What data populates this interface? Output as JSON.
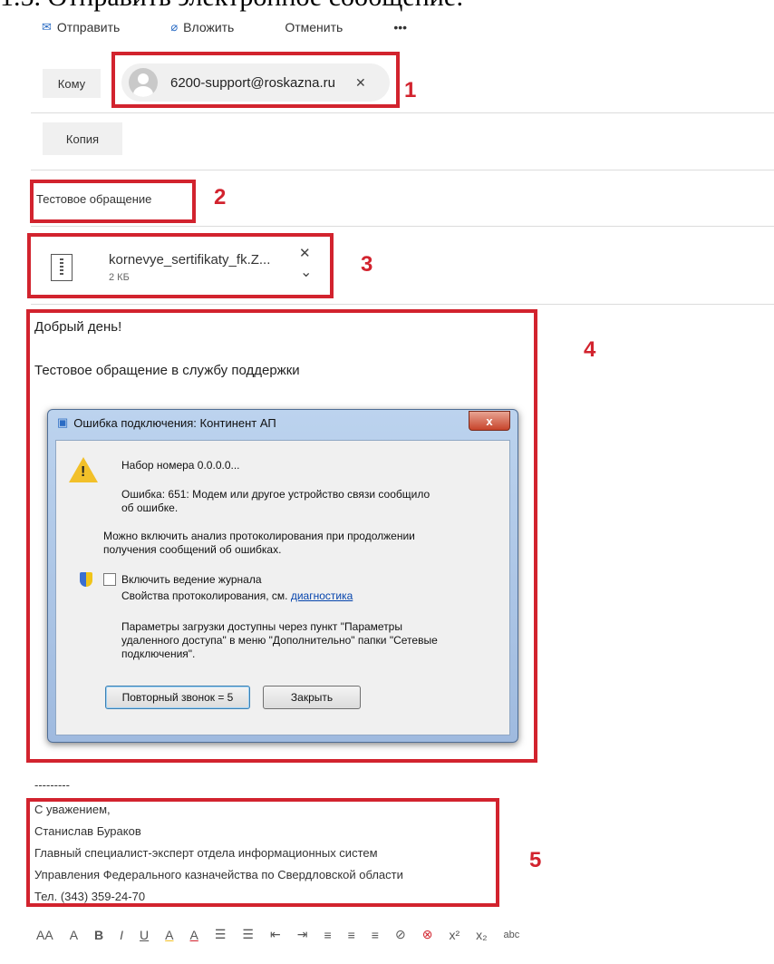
{
  "heading": "1.5.    Отправить электронное сообщение:",
  "toolbar": {
    "send": "Отправить",
    "attach": "Вложить",
    "cancel": "Отменить",
    "more": "•••"
  },
  "to": {
    "label": "Кому",
    "recipient": "6200-support@roskazna.ru",
    "remove": "✕"
  },
  "cc": {
    "label": "Копия"
  },
  "subject": "Тестовое обращение",
  "attachment": {
    "name": "kornevye_sertifikaty_fk.Z...",
    "size": "2 КБ",
    "remove": "✕",
    "expand": "⌄"
  },
  "body": {
    "greeting": "Добрый день!",
    "text": "Тестовое обращение в службу поддержки"
  },
  "dialog": {
    "title": "Ошибка подключения: Континент АП",
    "close": "x",
    "dialing": "Набор номера 0.0.0.0...",
    "error_line1": "Ошибка: 651: Модем или другое устройство связи сообщило",
    "error_line2": "об ошибке.",
    "logging_line1": "Можно включить анализ протоколирования при продолжении",
    "logging_line2": "получения сообщений об ошибках.",
    "checkbox_label": "Включить ведение журнала",
    "props_prefix": "Свойства протоколирования, см.",
    "props_link": "диагностика",
    "params_line1": "Параметры загрузки доступны через пункт \"Параметры",
    "params_line2": "удаленного доступа\" в меню \"Дополнительно\" папки \"Сетевые",
    "params_line3": "подключения\".",
    "redial_button": "Повторный звонок = 5",
    "close_button": "Закрыть"
  },
  "signature": {
    "separator": "---------",
    "line1": "С уважением,",
    "line2": "Станислав Бураков",
    "line3": "Главный специалист-эксперт  отдела информационных систем",
    "line4": "Управления Федерального казначейства по Свердловской области",
    "line5": "Тел. (343) 359-24-70"
  },
  "markers": [
    "1",
    "2",
    "3",
    "4",
    "5"
  ],
  "format_toolbar": [
    "AA",
    "A",
    "B",
    "I",
    "U",
    "A",
    "A",
    "☰",
    "☰",
    "⇤",
    "⇥",
    "≡",
    "≡",
    "≡",
    "⊘",
    "⊗",
    "x²",
    "x₂",
    "abc"
  ],
  "colors": {
    "marker_red": "#d2232e",
    "accent_blue": "#2b6cc4"
  }
}
